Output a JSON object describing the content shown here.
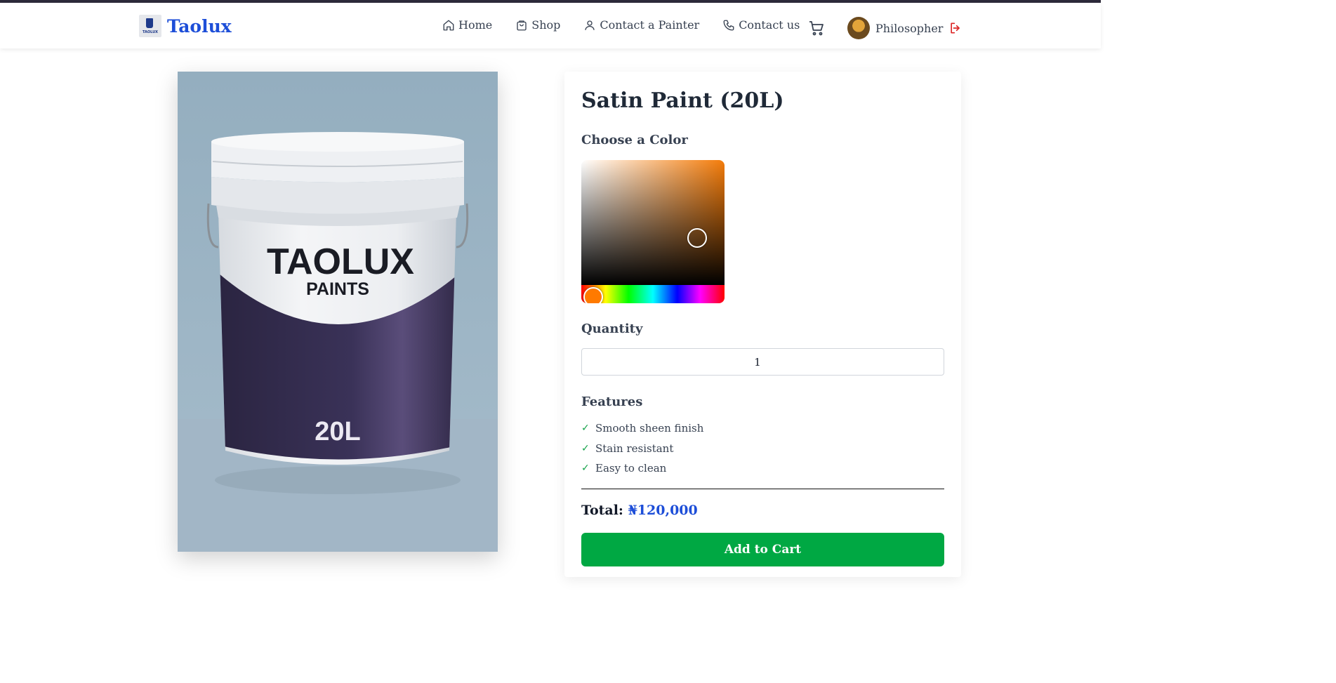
{
  "brand": {
    "name": "Taolux",
    "logo_text": "TAOLUX"
  },
  "nav": {
    "home": "Home",
    "shop": "Shop",
    "contact_painter": "Contact a Painter",
    "contact_us": "Contact us"
  },
  "user": {
    "name": "Philosopher"
  },
  "product": {
    "image_brand": "TAOLUX",
    "image_line": "PAINTS",
    "image_size": "20L",
    "title": "Satin Paint (20L)",
    "color_heading": "Choose a Color",
    "selected_color": "#f47c0a",
    "quantity_heading": "Quantity",
    "quantity": "1",
    "features_heading": "Features",
    "features": [
      "Smooth sheen finish",
      "Stain resistant",
      "Easy to clean"
    ],
    "total_label": "Total:",
    "total_value": "₦120,000",
    "add_to_cart": "Add to Cart"
  },
  "icons": [
    "home-icon",
    "shopping-bag-icon",
    "user-icon",
    "phone-icon",
    "cart-icon",
    "logout-icon",
    "check-icon"
  ],
  "colors": {
    "brand": "#1d4ed8",
    "button": "#00a843",
    "check": "#16a34a",
    "logout": "#dc2626"
  }
}
